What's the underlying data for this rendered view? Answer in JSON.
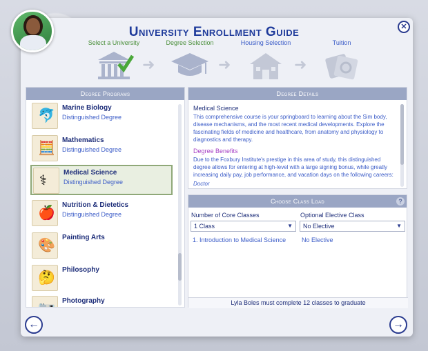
{
  "header": {
    "title": "University Enrollment Guide",
    "close_icon": "close-icon"
  },
  "steps": [
    {
      "label": "Select a University",
      "icon": "courthouse-icon",
      "completed": true,
      "color": "#4a8f3a"
    },
    {
      "label": "Degree Selection",
      "icon": "graduation-cap-icon",
      "completed": false,
      "color": "#4a8f3a"
    },
    {
      "label": "Housing Selection",
      "icon": "house-icon",
      "completed": false,
      "color": "#3a5bc7"
    },
    {
      "label": "Tuition",
      "icon": "money-icon",
      "completed": false,
      "color": "#3a5bc7"
    }
  ],
  "degree_programs": {
    "header": "Degree Programs",
    "items": [
      {
        "name": "Marine Biology",
        "sub": "Distinguished Degree",
        "icon": "dolphin-icon"
      },
      {
        "name": "Mathematics",
        "sub": "Distinguished Degree",
        "icon": "calculator-icon"
      },
      {
        "name": "Medical Science",
        "sub": "Distinguished Degree",
        "icon": "caduceus-icon",
        "selected": true
      },
      {
        "name": "Nutrition & Dietetics",
        "sub": "Distinguished Degree",
        "icon": "apple-icon"
      },
      {
        "name": "Painting Arts",
        "sub": "",
        "icon": "palette-icon"
      },
      {
        "name": "Philosophy",
        "sub": "",
        "icon": "thinker-icon"
      },
      {
        "name": "Photography",
        "sub": "",
        "icon": "camera-icon"
      }
    ]
  },
  "degree_details": {
    "header": "Degree Details",
    "name": "Medical Science",
    "description": "This comprehensive course is your springboard to learning about the Sim body, disease mechanisms, and the most recent medical developments. Explore the fascinating fields of medicine and healthcare, from anatomy and physiology to diagnostics and therapy.",
    "benefits_heading": "Degree Benefits",
    "benefits_text": "Due to the Foxbury Institute's prestige in this area of study, this distinguished degree allows for entering at high-level with a large signing bonus, while greatly increasing daily pay, job performance, and vacation days on the following careers:",
    "career_partial": "Doctor"
  },
  "class_load": {
    "header": "Choose Class Load",
    "help_icon": "help-icon",
    "core_label": "Number of Core Classes",
    "core_value": "1 Class",
    "elective_label": "Optional Elective Class",
    "elective_value": "No Elective",
    "core_class": "1. Introduction to Medical Science",
    "elective_class": "No Elective",
    "footer": "Lyla Boles must complete 12 classes to graduate"
  },
  "nav": {
    "back_icon": "arrow-left-icon",
    "next_icon": "arrow-right-icon"
  },
  "colors": {
    "accent": "#1f3b9b",
    "panel_header": "#9aa6c4",
    "selected_border": "#8fa878"
  }
}
